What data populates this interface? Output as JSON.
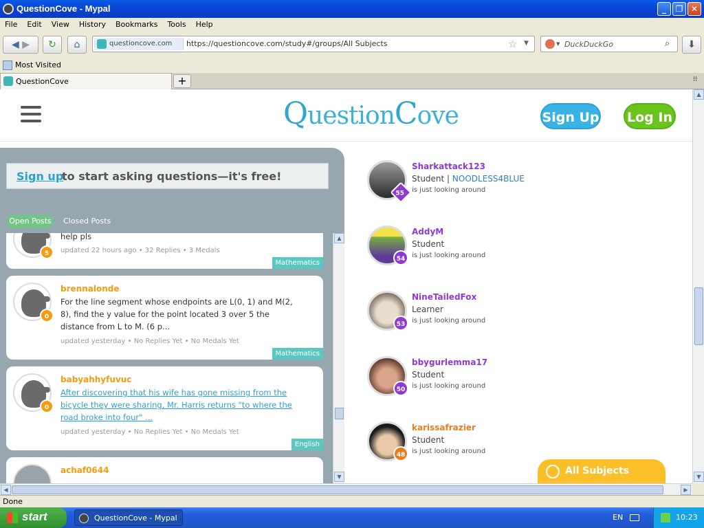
{
  "window": {
    "title": "QuestionCove - Mypal"
  },
  "menu": [
    "File",
    "Edit",
    "View",
    "History",
    "Bookmarks",
    "Tools",
    "Help"
  ],
  "nav": {
    "site_label": "questioncove.com",
    "url": "https://questioncove.com/study#/groups/All Subjects",
    "search_placeholder": "DuckDuckGo"
  },
  "bookmarks": {
    "most_visited": "Most Visited"
  },
  "tab": {
    "title": "QuestionCove",
    "new_tab": "+"
  },
  "site": {
    "logo": {
      "q": "Q",
      "mid": "uestion",
      "c": "C",
      "end": "ove"
    },
    "signup": "Sign Up",
    "login": "Log In"
  },
  "cta": {
    "link": "Sign up",
    "text": "to start asking questions—it's free!"
  },
  "feed_tabs": {
    "open": "Open Posts",
    "closed": "Closed Posts"
  },
  "posts": [
    {
      "badge": "5",
      "text": "help pls",
      "meta": "updated 22 hours ago  •  32 Replies  •  3 Medals",
      "subject": "Mathematics"
    },
    {
      "badge": "0",
      "user": "brennalonde",
      "text": "For the line segment whose endpoints are L(0, 1) and M(2, 8), find the y value for the point located 3 over 5 the distance from L to M. (6 p...",
      "meta": "updated yesterday  •  No Replies Yet  •  No Medals Yet",
      "subject": "Mathematics"
    },
    {
      "badge": "0",
      "user": "babyahhyfuvuc",
      "text": "After discovering that his wife has gone missing from the bicycle they were sharing, Mr. Harris returns \"to where the road broke into four\" ...",
      "meta": "updated yesterday  •  No Replies Yet  •  No Medals Yet",
      "subject": "English"
    },
    {
      "user": "achaf0644"
    }
  ],
  "users": [
    {
      "name": "Sharkattack123",
      "role": "Student | ",
      "team": "NOODLESS4BLUE",
      "activity": "is just looking around",
      "level": "55"
    },
    {
      "name": "AddyM",
      "role": "Student",
      "activity": "is just looking around",
      "level": "54"
    },
    {
      "name": "NineTailedFox",
      "role": "Learner",
      "activity": "is just looking around",
      "level": "53"
    },
    {
      "name": "bbygurlemma17",
      "role": "Student",
      "activity": "is just looking around",
      "level": "50"
    },
    {
      "name": "karissafrazier",
      "role": "Student",
      "activity": "is just looking around",
      "level": "48"
    }
  ],
  "subjects_button": "All Subjects",
  "status": "Done",
  "taskbar": {
    "start": "start",
    "item": "QuestionCove - Mypal",
    "lang": "EN",
    "clock": "10:23"
  },
  "colors": {
    "accent": "#3bb2e6",
    "login": "#6ac41e",
    "panel": "#96a7b0",
    "username": "#f39c12",
    "level": "#8e3ad0"
  }
}
